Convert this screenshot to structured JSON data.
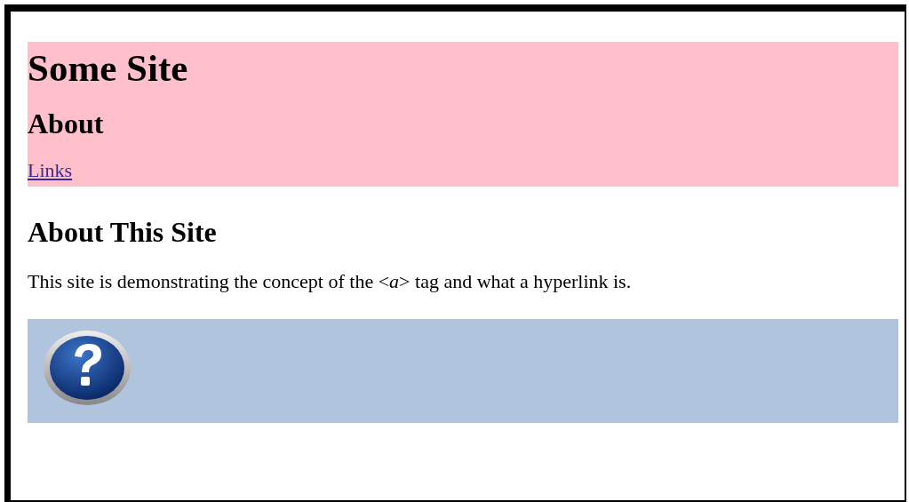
{
  "header": {
    "title": "Some Site",
    "subtitle": "About",
    "link": "Links"
  },
  "main": {
    "heading": "About This Site",
    "paragraph": "This site is demonstrating the concept of the <*a*> tag and what a hyperlink is."
  },
  "footer": {
    "kind": "help-icon"
  }
}
